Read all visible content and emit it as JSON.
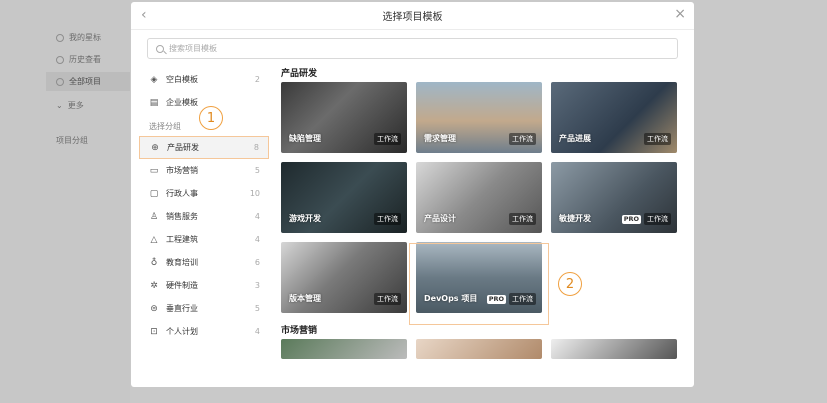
{
  "background": {
    "sidebar_items": [
      {
        "label": "我的星标",
        "icon": "star-icon"
      },
      {
        "label": "历史查看",
        "icon": "history-icon"
      },
      {
        "label": "全部项目",
        "icon": "box-icon"
      },
      {
        "label": "更多",
        "icon": "chevron-down-icon"
      }
    ],
    "projects_label": "项目分组"
  },
  "dialog": {
    "title": "选择项目模板",
    "search_placeholder": "搜索项目模板"
  },
  "nav": {
    "top_items": [
      {
        "label": "空白模板",
        "count": "2",
        "icon": "cube-icon"
      },
      {
        "label": "企业模板",
        "count": "",
        "icon": "building-icon"
      }
    ],
    "group_label": "选择分组",
    "group_items": [
      {
        "label": "产品研发",
        "count": "8",
        "icon": "globe-icon"
      },
      {
        "label": "市场营销",
        "count": "5",
        "icon": "briefcase-icon"
      },
      {
        "label": "行政人事",
        "count": "10",
        "icon": "monitor-icon"
      },
      {
        "label": "销售服务",
        "count": "4",
        "icon": "user-icon"
      },
      {
        "label": "工程建筑",
        "count": "4",
        "icon": "warning-icon"
      },
      {
        "label": "教育培训",
        "count": "6",
        "icon": "cup-icon"
      },
      {
        "label": "硬件制造",
        "count": "3",
        "icon": "gear-icon"
      },
      {
        "label": "垂直行业",
        "count": "5",
        "icon": "layers-icon"
      },
      {
        "label": "个人计划",
        "count": "4",
        "icon": "gift-icon"
      }
    ]
  },
  "sections": [
    {
      "title": "产品研发",
      "cards": [
        {
          "name": "缺陷管理",
          "workflow": "工作流",
          "pro": ""
        },
        {
          "name": "需求管理",
          "workflow": "工作流",
          "pro": ""
        },
        {
          "name": "产品进展",
          "workflow": "工作流",
          "pro": ""
        },
        {
          "name": "游戏开发",
          "workflow": "工作流",
          "pro": ""
        },
        {
          "name": "产品设计",
          "workflow": "工作流",
          "pro": ""
        },
        {
          "name": "敏捷开发",
          "workflow": "工作流",
          "pro": "PRO"
        },
        {
          "name": "版本管理",
          "workflow": "工作流",
          "pro": ""
        },
        {
          "name": "DevOps 项目",
          "workflow": "工作流",
          "pro": "PRO"
        }
      ]
    },
    {
      "title": "市场营销"
    }
  ],
  "callouts": [
    "1",
    "2"
  ],
  "colors": {
    "highlight": "#f5c79a",
    "callout": "#f0a040"
  }
}
